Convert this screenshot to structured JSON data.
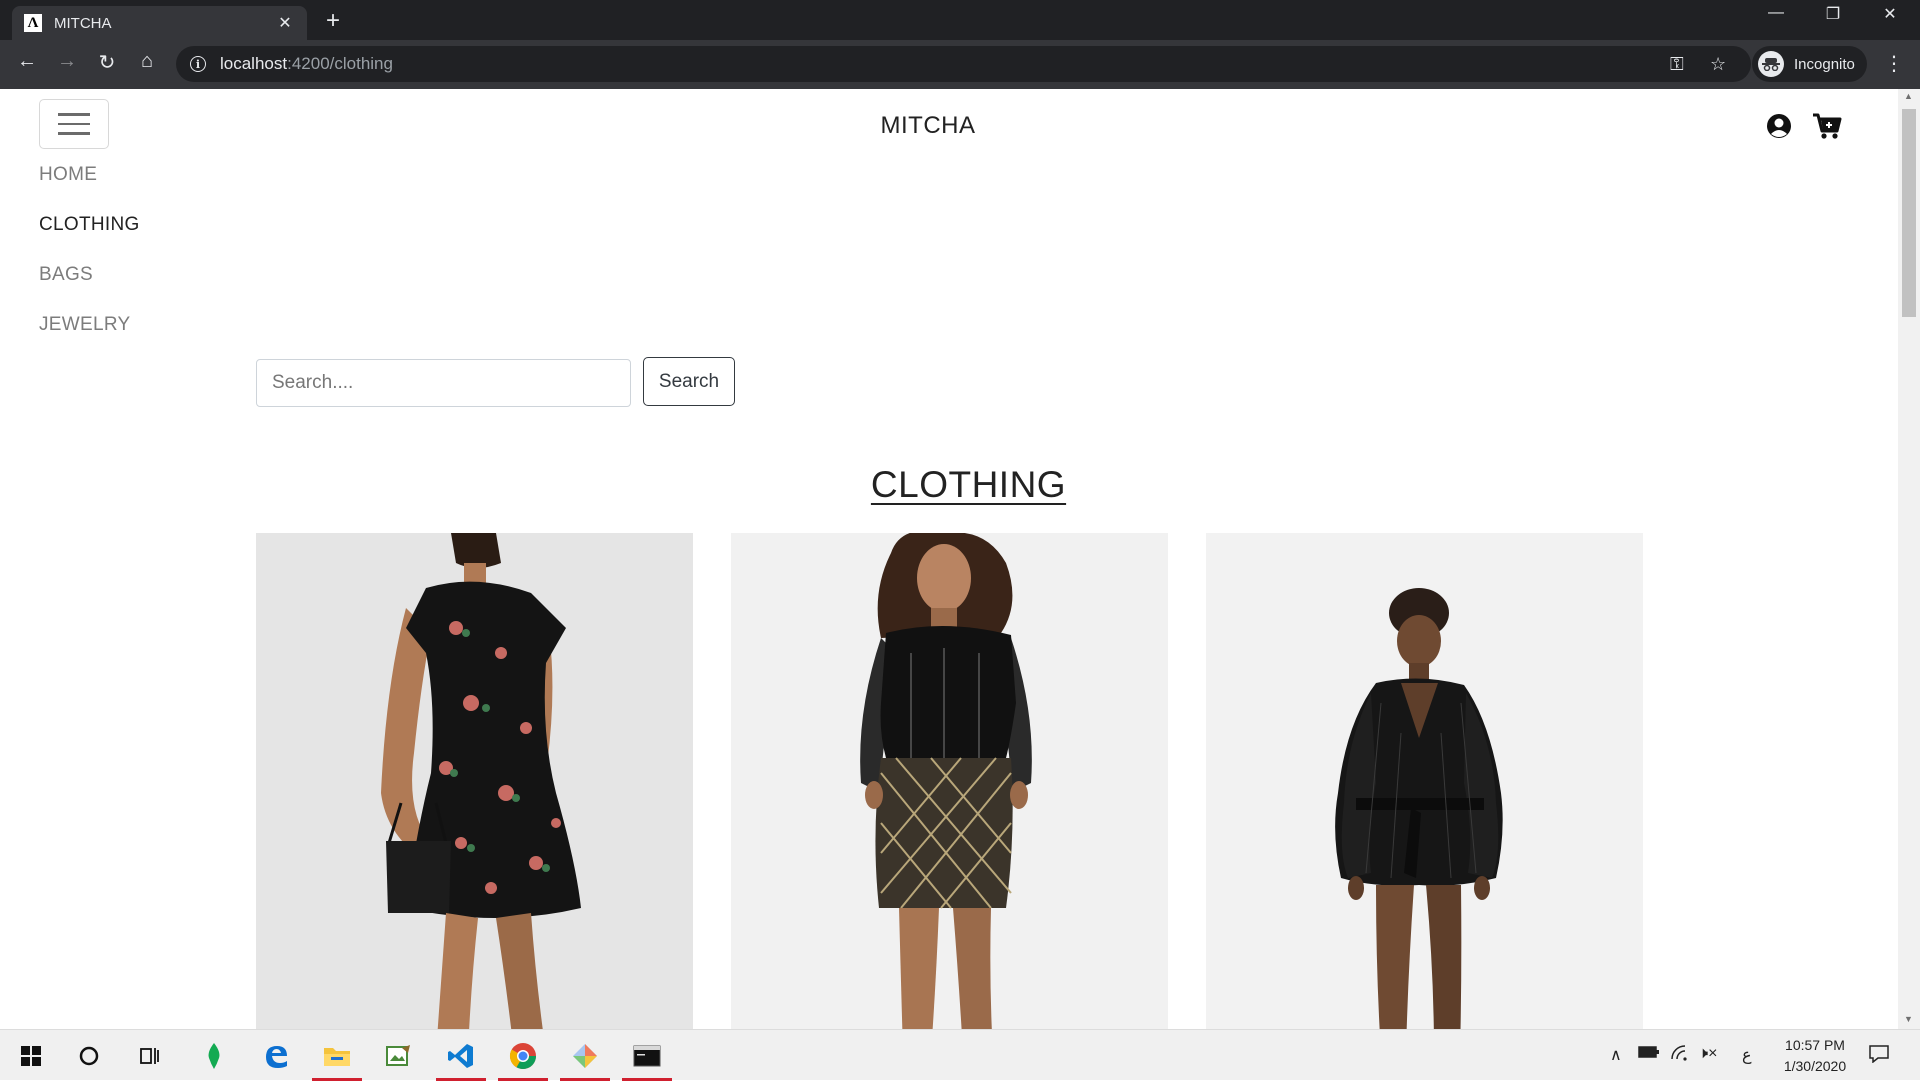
{
  "browser": {
    "tab_title": "MITCHA",
    "tab_favicon": "Λ",
    "url_host": "localhost",
    "url_path": ":4200/clothing",
    "incognito_label": "Incognito"
  },
  "header": {
    "brand": "MITCHA"
  },
  "sidebar": {
    "items": [
      {
        "label": "HOME",
        "active": false
      },
      {
        "label": "CLOTHING",
        "active": true
      },
      {
        "label": "BAGS",
        "active": false
      },
      {
        "label": "JEWELRY",
        "active": false
      }
    ]
  },
  "search": {
    "placeholder": "Search....",
    "button_label": "Search"
  },
  "main": {
    "section_title": "CLOTHING"
  },
  "products": [
    {
      "icon": "floral-dress-image"
    },
    {
      "icon": "corset-dress-image"
    },
    {
      "icon": "wrap-dress-image"
    }
  ],
  "taskbar": {
    "time": "10:57 PM",
    "date": "1/30/2020",
    "apps": [
      "start-icon",
      "cortana-icon",
      "task-view-icon",
      "mongodb-icon",
      "edge-icon",
      "file-explorer-icon",
      "editor-icon",
      "vscode-icon",
      "chrome-icon",
      "git-icon",
      "terminal-icon"
    ]
  },
  "colors": {
    "chrome_dark": "#202124",
    "chrome_toolbar": "#35363a",
    "text_dark": "#222222",
    "nav_muted": "#7c7c7c",
    "running_indicator": "#d0202f"
  }
}
